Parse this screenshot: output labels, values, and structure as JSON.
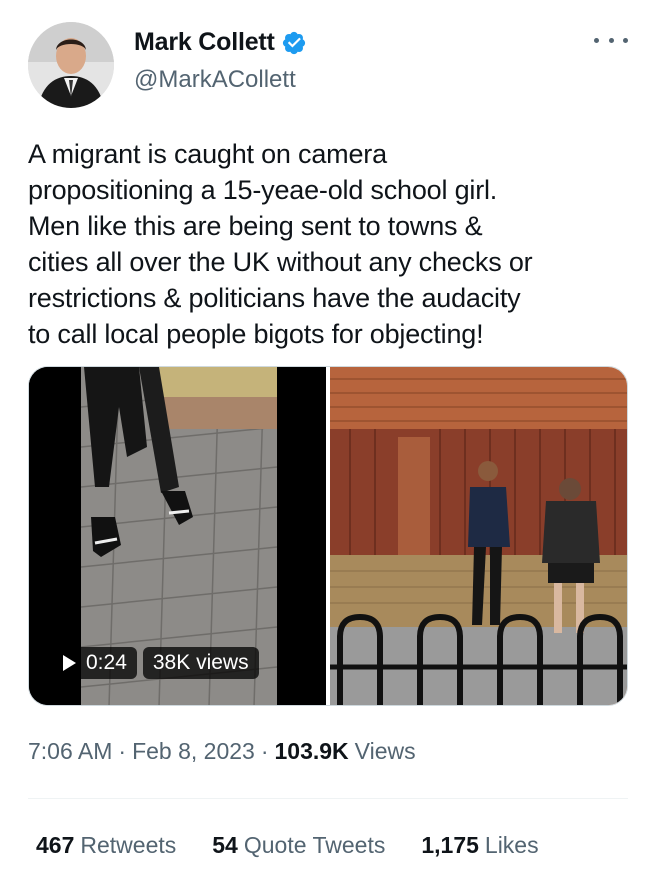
{
  "author": {
    "display_name": "Mark Collett",
    "handle": "@MarkACollett",
    "verified_icon": "verified-badge-icon",
    "verified_color": "#1d9bf0"
  },
  "tweet": {
    "text": "A migrant is caught on camera\npropositioning a 15-yeae-old school girl.\nMen like this are being sent to towns &\ncities all over the UK without any checks or\nrestrictions & politicians have the audacity\nto call local people bigots for objecting!"
  },
  "media": {
    "video": {
      "duration": "0:24",
      "views": "38K views"
    }
  },
  "meta": {
    "time": "7:06 AM",
    "separator": "·",
    "date": "Feb 8, 2023",
    "views_count": "103.9K",
    "views_label": "Views"
  },
  "stats": [
    {
      "count": "467",
      "label": "Retweets"
    },
    {
      "count": "54",
      "label": "Quote Tweets"
    },
    {
      "count": "1,175",
      "label": "Likes"
    }
  ],
  "colors": {
    "text": "#0f1419",
    "secondary": "#536471",
    "border": "#cfd9de",
    "accent": "#1d9bf0"
  }
}
